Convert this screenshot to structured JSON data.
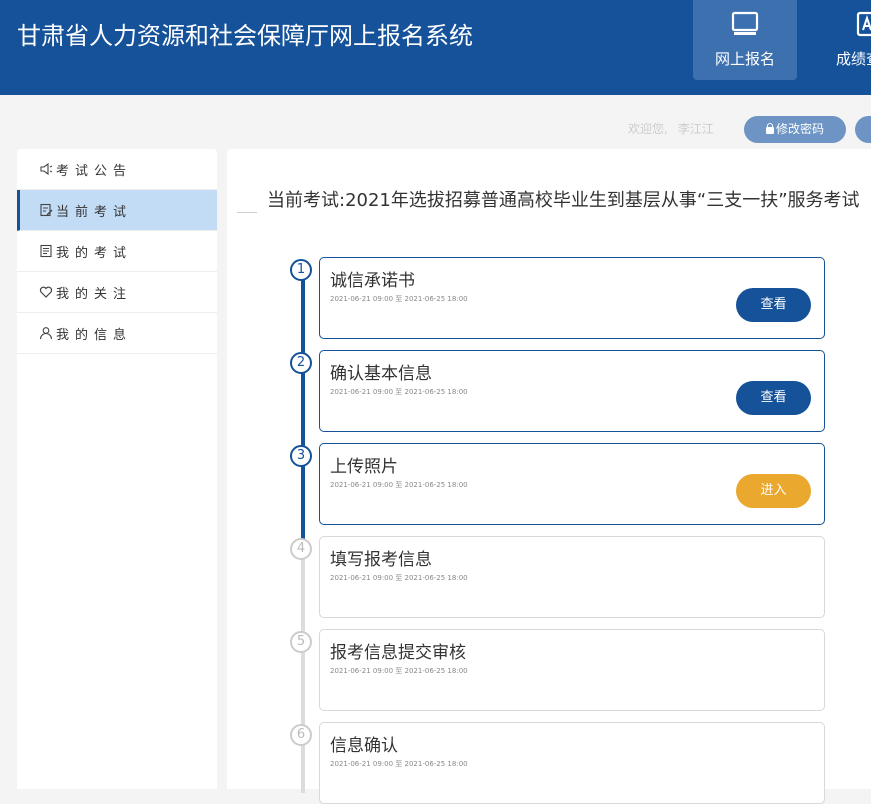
{
  "header": {
    "title": "甘肃省人力资源和社会保障厅网上报名系统",
    "nav": [
      {
        "label": "网上报名",
        "icon": "monitor-icon",
        "active": true
      },
      {
        "label": "成绩查询",
        "icon": "grade-icon",
        "active": false
      }
    ]
  },
  "user": {
    "welcome": "欢迎您,",
    "name": "李江江",
    "change_password": "修改密码"
  },
  "sidebar": {
    "items": [
      {
        "label": "考试公告",
        "icon": "megaphone-icon"
      },
      {
        "label": "当前考试",
        "icon": "edit-document-icon"
      },
      {
        "label": "我的考试",
        "icon": "document-list-icon"
      },
      {
        "label": "我的关注",
        "icon": "heart-icon"
      },
      {
        "label": "我的信息",
        "icon": "user-icon"
      }
    ],
    "active_index": 1
  },
  "main": {
    "exam_title": "当前考试:2021年选拔招募普通高校毕业生到基层从事“三支一扶”服务考试",
    "steps": [
      {
        "number": "1",
        "title": "诚信承诺书",
        "time": "2021-06-21 09:00 至 2021-06-25 18:00",
        "button": "查看",
        "button_type": "view",
        "active": true
      },
      {
        "number": "2",
        "title": "确认基本信息",
        "time": "2021-06-21 09:00 至 2021-06-25 18:00",
        "button": "查看",
        "button_type": "view",
        "active": true
      },
      {
        "number": "3",
        "title": "上传照片",
        "time": "2021-06-21 09:00 至 2021-06-25 18:00",
        "button": "进入",
        "button_type": "enter",
        "active": true
      },
      {
        "number": "4",
        "title": "填写报考信息",
        "time": "2021-06-21 09:00 至 2021-06-25 18:00",
        "button": "",
        "active": false
      },
      {
        "number": "5",
        "title": "报考信息提交审核",
        "time": "2021-06-21 09:00 至 2021-06-25 18:00",
        "button": "",
        "active": false
      },
      {
        "number": "6",
        "title": "信息确认",
        "time": "2021-06-21 09:00 至 2021-06-25 18:00",
        "button": "",
        "active": false
      }
    ]
  },
  "colors": {
    "primary": "#15529a",
    "accent": "#eaa82f",
    "active_nav": "#3d70ae",
    "sidebar_active": "#c3dcf5",
    "inactive_step": "#cccccc"
  }
}
